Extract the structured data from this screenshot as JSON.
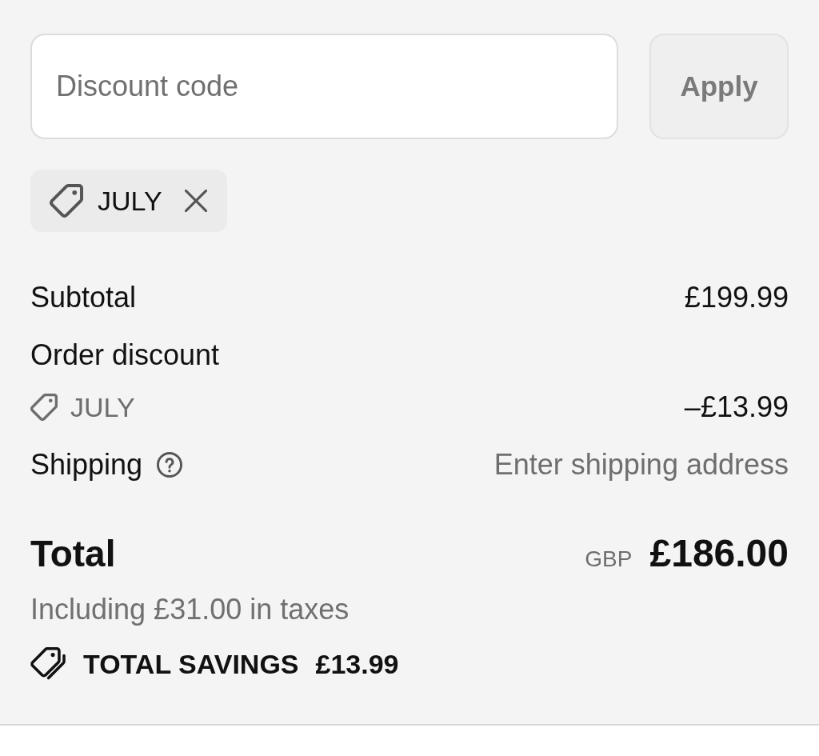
{
  "discount": {
    "field": {
      "placeholder": "Discount code"
    },
    "apply_button": {
      "label": "Apply",
      "disabled": true
    }
  },
  "applied_codes": [
    {
      "code": "JULY"
    }
  ],
  "summary_lines": [
    {
      "kind": "amount",
      "label": "Subtotal",
      "value": "£199.99"
    },
    {
      "kind": "discount",
      "label": "Order discount",
      "code": "JULY",
      "value": "–£13.99"
    },
    {
      "kind": "shipping",
      "label": "Shipping",
      "value": "Enter shipping address"
    }
  ],
  "total": {
    "label": "Total",
    "currency": "GBP",
    "amount": "£186.00",
    "tax_note": "Including £31.00 in taxes"
  },
  "savings": {
    "label": "TOTAL SAVINGS",
    "amount": "£13.99"
  }
}
